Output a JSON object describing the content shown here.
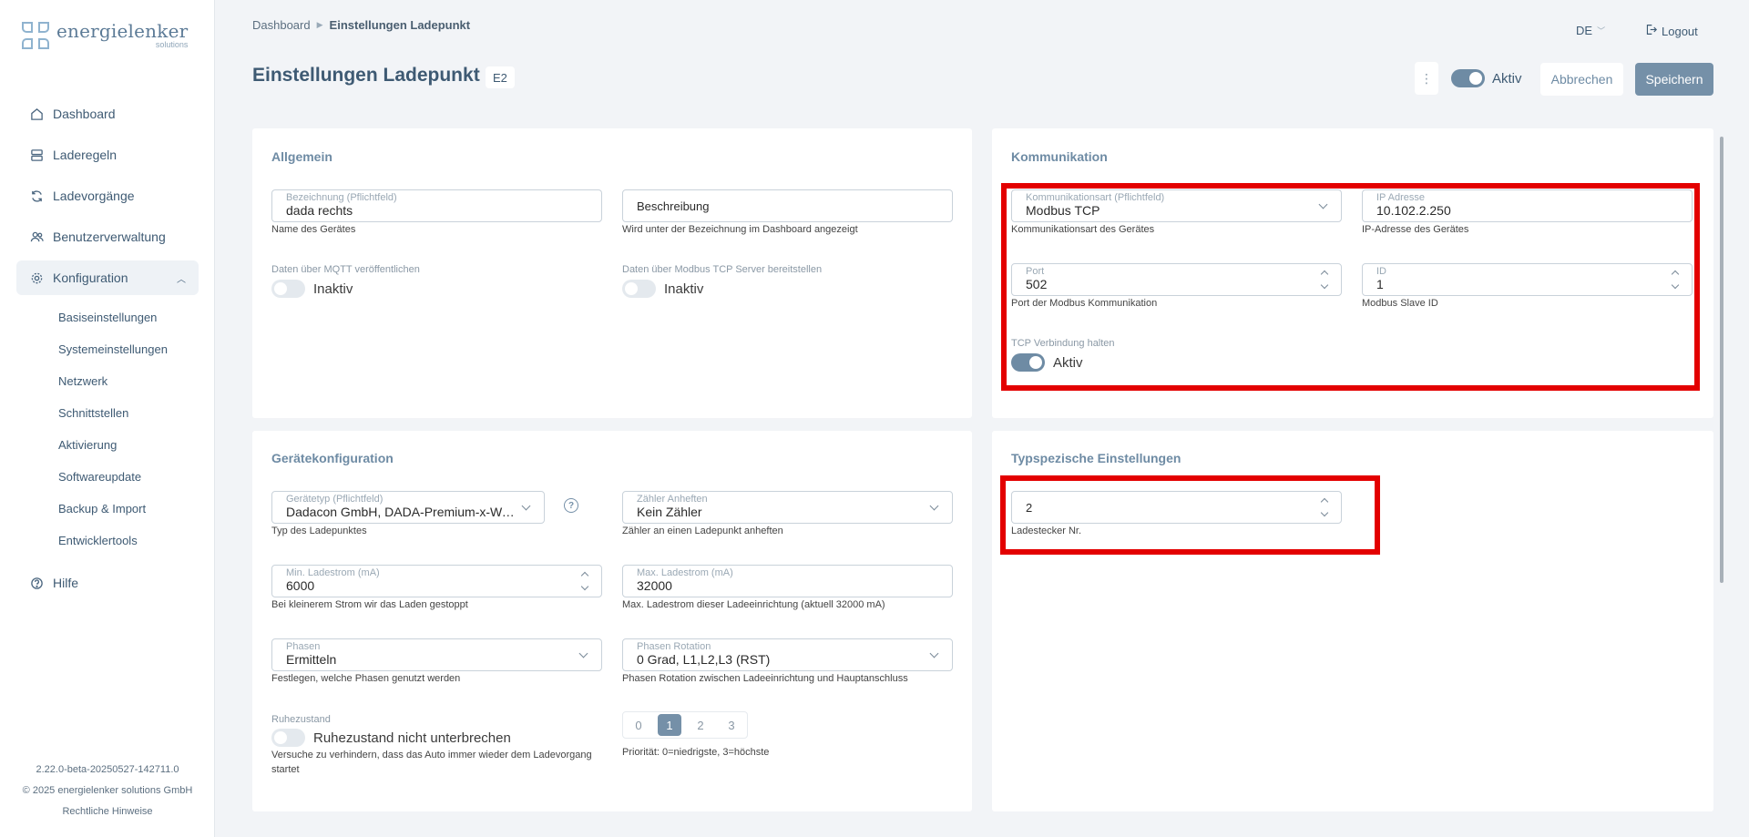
{
  "brand": {
    "name": "energielenker",
    "sub": "solutions"
  },
  "nav": {
    "items": [
      {
        "label": "Dashboard",
        "icon": "home-icon"
      },
      {
        "label": "Laderegeln",
        "icon": "rules-icon"
      },
      {
        "label": "Ladevorgänge",
        "icon": "sync-icon"
      },
      {
        "label": "Benutzerverwaltung",
        "icon": "users-icon"
      },
      {
        "label": "Konfiguration",
        "icon": "gear-icon"
      }
    ],
    "sub": [
      "Basiseinstellungen",
      "Systemeinstellungen",
      "Netzwerk",
      "Schnittstellen",
      "Aktivierung",
      "Softwareupdate",
      "Backup & Import",
      "Entwicklertools"
    ],
    "help": "Hilfe"
  },
  "footer": {
    "version": "2.22.0-beta-20250527-142711.0",
    "copyright": "© 2025 energielenker solutions GmbH",
    "legal": "Rechtliche Hinweise"
  },
  "breadcrumb": {
    "home": "Dashboard",
    "current": "Einstellungen Ladepunkt"
  },
  "header": {
    "lang": "DE",
    "logout": "Logout",
    "title": "Einstellungen Ladepunkt",
    "badge": "E2",
    "more": "⋮",
    "active_label": "Aktiv",
    "cancel": "Abbrechen",
    "save": "Speichern"
  },
  "allgemein": {
    "title": "Allgemein",
    "name_label": "Bezeichnung (Pflichtfeld)",
    "name_value": "dada rechts",
    "name_help": "Name des Gerätes",
    "desc_placeholder": "Beschreibung",
    "desc_help": "Wird unter der Bezeichnung im Dashboard angezeigt",
    "mqtt_label": "Daten über MQTT veröffentlichen",
    "mqtt_state": "Inaktiv",
    "modbus_label": "Daten über Modbus TCP Server bereitstellen",
    "modbus_state": "Inaktiv"
  },
  "kommunikation": {
    "title": "Kommunikation",
    "type_label": "Kommunikationsart (Pflichtfeld)",
    "type_value": "Modbus TCP",
    "type_help": "Kommunikationsart des Gerätes",
    "ip_label": "IP Adresse",
    "ip_value": "10.102.2.250",
    "ip_help": "IP-Adresse des Gerätes",
    "port_label": "Port",
    "port_value": "502",
    "port_help": "Port der Modbus Kommunikation",
    "id_label": "ID",
    "id_value": "1",
    "id_help": "Modbus Slave ID",
    "tcp_label": "TCP Verbindung halten",
    "tcp_state": "Aktiv"
  },
  "geraet": {
    "title": "Gerätekonfiguration",
    "type_label": "Gerätetyp (Pflichtfeld)",
    "type_value": "Dadacon GmbH, DADA-Premium-x-Wallbox...",
    "type_help": "Typ des Ladepunktes",
    "help_icon": "?",
    "meter_label": "Zähler Anheften",
    "meter_value": "Kein Zähler",
    "meter_help": "Zähler an einen Ladepunkt anheften",
    "min_label": "Min. Ladestrom (mA)",
    "min_value": "6000",
    "min_help": "Bei kleinerem Strom wir das Laden gestoppt",
    "max_label": "Max. Ladestrom (mA)",
    "max_value": "32000",
    "max_help": "Max. Ladestrom dieser Ladeeinrichtung (aktuell 32000 mA)",
    "phases_label": "Phasen",
    "phases_value": "Ermitteln",
    "phases_help": "Festlegen, welche Phasen genutzt werden",
    "rot_label": "Phasen Rotation",
    "rot_value": "0 Grad, L1,L2,L3 (RST)",
    "rot_help": "Phasen Rotation zwischen Ladeeinrichtung und Hauptanschluss",
    "rest_label": "Ruhezustand",
    "rest_state": "Ruhezustand nicht unterbrechen",
    "rest_help_1": "Versuche zu verhindern, dass das Auto immer wieder dem Ladevorgang",
    "rest_help_2": "startet",
    "prio_options": [
      "0",
      "1",
      "2",
      "3"
    ],
    "prio_selected": "1",
    "prio_help": "Priorität: 0=niedrigste, 3=höchste"
  },
  "typ": {
    "title": "Typspezische Einstellungen",
    "plug_value": "2",
    "plug_help": "Ladestecker Nr."
  },
  "colors": {
    "accent": "#7590a8",
    "highlight": "#e30000",
    "text": "#3e5a73"
  }
}
